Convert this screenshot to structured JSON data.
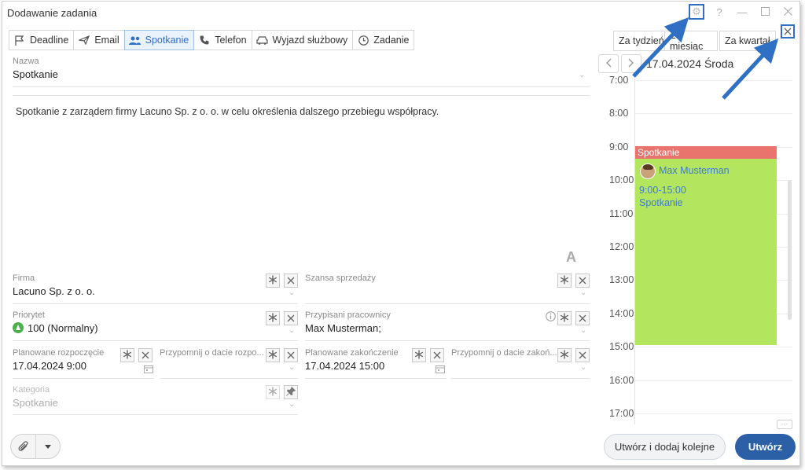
{
  "window": {
    "title": "Dodawanie zadania"
  },
  "titlebar_controls": {
    "gear": "gear-icon",
    "help": "?",
    "minimize": "minimize-icon",
    "maximize": "maximize-icon",
    "close": "close-icon"
  },
  "tabs": [
    {
      "label": "Deadline",
      "icon": "flag-icon"
    },
    {
      "label": "Email",
      "icon": "send-icon"
    },
    {
      "label": "Spotkanie",
      "icon": "people-icon",
      "active": true
    },
    {
      "label": "Telefon",
      "icon": "phone-icon"
    },
    {
      "label": "Wyjazd służbowy",
      "icon": "car-icon"
    },
    {
      "label": "Zadanie",
      "icon": "clock-icon"
    }
  ],
  "form": {
    "name": {
      "label": "Nazwa",
      "value": "Spotkanie"
    },
    "description": "Spotkanie z zarządem firmy Lacuno Sp. z o. o. w celu określenia dalszego przebiegu współpracy.",
    "font_button": "A",
    "firma": {
      "label": "Firma",
      "value": "Lacuno Sp. z o. o."
    },
    "szansa": {
      "label": "Szansa sprzedaży",
      "value": ""
    },
    "priorytet": {
      "label": "Priorytet",
      "value": "100 (Normalny)"
    },
    "pracownicy": {
      "label": "Przypisani pracownicy",
      "value": "Max Musterman;"
    },
    "plan_start": {
      "label": "Planowane rozpoczęcie",
      "value": "17.04.2024 9:00"
    },
    "remind_start": {
      "label": "Przypomnij o dacie rozpo...",
      "value": ""
    },
    "plan_end": {
      "label": "Planowane zakończenie",
      "value": "17.04.2024 15:00"
    },
    "remind_end": {
      "label": "Przypomnij o dacie zakoń...",
      "value": ""
    },
    "kategoria": {
      "label": "Kategoria",
      "value": "Spotkanie"
    }
  },
  "calendar": {
    "ranges": [
      "Za tydzień",
      "Za miesiąc",
      "Za kwartał"
    ],
    "date": "17.04.2024 Środa",
    "hours": [
      "7:00",
      "8:00",
      "9:00",
      "10:00",
      "11:00",
      "12:00",
      "13:00",
      "14:00",
      "15:00",
      "16:00",
      "17:00"
    ],
    "event": {
      "title": "Spotkanie",
      "person": "Max Musterman",
      "time": "9:00-15:00",
      "type": "Spotkanie",
      "head_color": "#e8746d",
      "body_color": "#b3e55e"
    },
    "more": "···"
  },
  "footer": {
    "create_and_next": "Utwórz i dodaj kolejne",
    "create": "Utwórz"
  },
  "colors": {
    "accent": "#2f6fc4",
    "primary_button": "#2b5fa6",
    "annotation_arrow": "#2f6fc4"
  }
}
